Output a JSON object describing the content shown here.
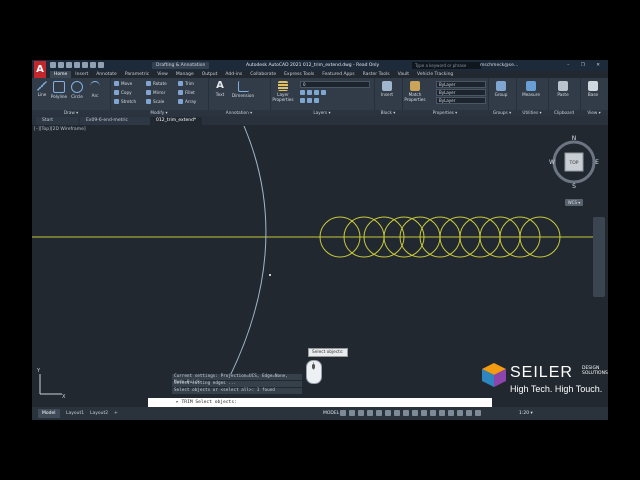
{
  "app": {
    "title": "Autodesk AutoCAD 2021   012_trim_extend.dwg - Read Only",
    "workspace": "Drafting & Annotation",
    "search_placeholder": "Type a keyword or phrase",
    "user": "mschmeck@se...",
    "window_controls": "– ❐ ✕"
  },
  "ribbon_tabs": [
    "Home",
    "Insert",
    "Annotate",
    "Parametric",
    "View",
    "Manage",
    "Output",
    "Add-ins",
    "Collaborate",
    "Express Tools",
    "Featured Apps",
    "Raster Tools",
    "Vault",
    "Vehicle Tracking"
  ],
  "active_tab": "Home",
  "panels": {
    "draw": {
      "title": "Draw ▾",
      "tools": [
        "Line",
        "Polyline",
        "Circle",
        "Arc"
      ]
    },
    "modify": {
      "title": "Modify ▾",
      "rows": [
        "Move",
        "Rotate",
        "Trim",
        "Copy",
        "Mirror",
        "Fillet",
        "Stretch",
        "Scale",
        "Array"
      ]
    },
    "annotation": {
      "title": "Annotation ▾",
      "tools": [
        "Text",
        "Dimension"
      ]
    },
    "layers": {
      "title": "Layers ▾",
      "tool": "Layer Properties",
      "layer_value": "0"
    },
    "block": {
      "title": "Block ▾",
      "tool": "Insert"
    },
    "properties": {
      "title": "Properties ▾",
      "tool": "Match Properties",
      "values": [
        "ByLayer",
        "ByLayer",
        "ByLayer"
      ]
    },
    "groups": {
      "title": "Groups ▾",
      "tool": "Group"
    },
    "utilities": {
      "title": "Utilities ▾",
      "tool": "Measure"
    },
    "clipboard": {
      "title": "Clipboard",
      "tool": "Paste"
    },
    "view": {
      "title": "View ▾",
      "tool": "Base"
    }
  },
  "doc_tabs": [
    "Start",
    "Ex09-6-end-metric",
    "012_trim_extend*"
  ],
  "viewport_label": "[–][Top][2D Wireframe]",
  "viewcube": {
    "face": "TOP",
    "n": "N",
    "s": "S",
    "e": "E",
    "w": "W",
    "wcs": "WCS ▾"
  },
  "tooltip": "Select objects:",
  "command_history": [
    "Current settings: Projection=UCS, Edge=None, Mode=Quick",
    "Select cutting edges ...",
    "Select objects or <select all>: 1 found"
  ],
  "command_prompt": "▸ TRIM Select objects:",
  "command_icons": "✕ ✎",
  "status": {
    "tabs": [
      "Model",
      "Layout1",
      "Layout2",
      "+"
    ],
    "model_button": "MODEL",
    "scale": "1:20 ▾"
  },
  "watermark": {
    "name": "SEILER",
    "sub": "DESIGN SOLUTIONS",
    "tagline": "High Tech. High Touch."
  },
  "colors": {
    "background": "#212830",
    "drawing": "#c9c93a",
    "arc": "#9fb8c8",
    "brand_red": "#c1272d"
  }
}
